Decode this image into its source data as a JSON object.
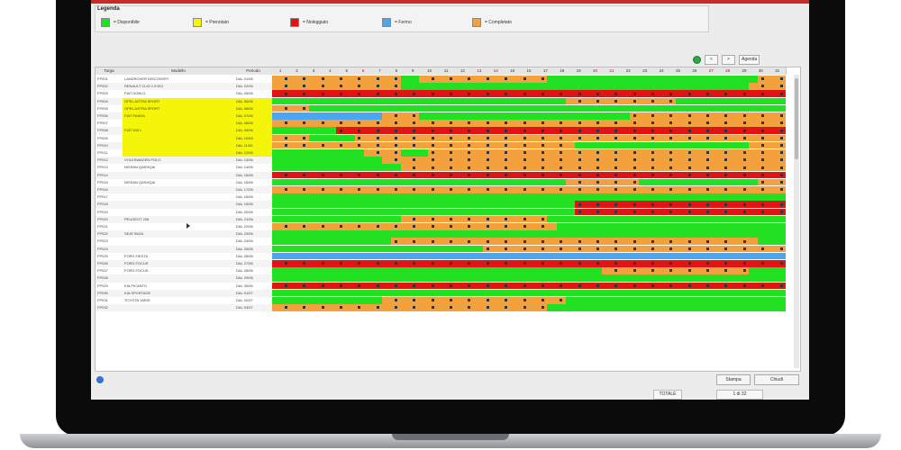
{
  "legend": {
    "title": "Legenda",
    "items": [
      {
        "key": "avail",
        "label": "= Disponibile",
        "color": "#22e122"
      },
      {
        "key": "pren",
        "label": "= Prenotato",
        "color": "#f5f50a"
      },
      {
        "key": "rent",
        "label": "= Noleggiato",
        "color": "#e01414"
      },
      {
        "key": "block",
        "label": "= Fermo",
        "color": "#4aa6f0"
      },
      {
        "key": "part",
        "label": "= Completato",
        "color": "#f2a13c"
      }
    ]
  },
  "toolbar": {
    "btn1": "<",
    "btn2": ">",
    "btn3": "Agenda"
  },
  "columns": {
    "plate": "Targa",
    "model": "Modello",
    "period": "Periodo"
  },
  "days": [
    "1",
    "2",
    "3",
    "4",
    "5",
    "6",
    "7",
    "8",
    "9",
    "10",
    "11",
    "12",
    "13",
    "14",
    "15",
    "16",
    "17",
    "18",
    "19",
    "20",
    "21",
    "22",
    "23",
    "24",
    "25",
    "26",
    "27",
    "28",
    "29",
    "30",
    "31"
  ],
  "rows": [
    {
      "plate": "FP001",
      "model": "LANDROVER DISCOVERY",
      "period": "DAL 01/06",
      "yellow": false,
      "cells": "ppppppppppppppggppppppppppppppgggggggggggggggggggggggp"
    },
    {
      "plate": "FP002",
      "model": "RENAULT CLIO 1.5 DCI",
      "period": "DAL 02/06",
      "yellow": false,
      "cells": "ppppppppppppppggggggggggggggggggggggggggggggggggggggp"
    },
    {
      "plate": "FP003",
      "model": "FIAT DOBLO",
      "period": "DAL 05/06",
      "yellow": false,
      "cells": "rrrrrrrrrrrrrrrrrrrrrrrrrrrrrrrrrrrrrrrrrrrrrrrrrrrrrr"
    },
    {
      "plate": "FP004",
      "model": "OPEL ASTRA SPORT",
      "period": "DAL 06/06",
      "yellow": true,
      "cells": "ggggggggggggggggggggggggggggggggppppppppppppggggggggggggg"
    },
    {
      "plate": "FP005",
      "model": "OPEL ASTRA SPORT",
      "period": "DAL 06/06",
      "yellow": true,
      "cells": "ppppggggggggggggggggggggggggggggggggggggggggggggggggggggg"
    },
    {
      "plate": "FP006",
      "model": "FIAT PANDA",
      "period": "DAL 07/06",
      "yellow": true,
      "cells": "bbbbbbbbbbbbppppgggggggggggggggggggggggppppppppppppppppp"
    },
    {
      "plate": "FP007",
      "model": "",
      "period": "DAL 08/06",
      "yellow": true,
      "cells": "ppppppppppppppppppppppppppppppppppppppppppppppppppppppp"
    },
    {
      "plate": "FP008",
      "model": "FIAT 500 L",
      "period": "DAL 09/06",
      "yellow": true,
      "cells": "gggggggrrrrrrrrrrrrrrrrrrrrrrrrrrrrrrrrrrrrrrrrrrrrrrrr"
    },
    {
      "plate": "FP009",
      "model": "",
      "period": "DAL 10/06",
      "yellow": true,
      "cells": "ppppgggggpppppppppppppppppppppppppppppppppppppppppppppp"
    },
    {
      "plate": "FP010",
      "model": "",
      "period": "DAL 11/06",
      "yellow": true,
      "cells": "pppppppppppppppppppppppppppppppppgggggggggggggggggggpppp"
    },
    {
      "plate": "FP011",
      "model": "",
      "period": "DAL 12/06",
      "yellow": true,
      "cells": "ggggggggggppppgggppppppppppppppppppppppppppppppppppppppp"
    },
    {
      "plate": "FP012",
      "model": "VOLKSWAGEN POLO",
      "period": "DAL 13/06",
      "yellow": false,
      "cells": "ggggggggggggppppppppppppppppppppppppppppppppppppppppppp"
    },
    {
      "plate": "FP013",
      "model": "NISSAN QASHQAI",
      "period": "DAL 14/06",
      "yellow": false,
      "cells": "ggggggggggggggppppppppppppppppppppppppppppppppppppppppp"
    },
    {
      "plate": "FP014",
      "model": "",
      "period": "DAL 15/06",
      "yellow": false,
      "cells": "rrrrrrrrrrrrrrrrrrrrrrrrrrrrrrrrrrrrrrrrrrrrrrrrrrrrrrr"
    },
    {
      "plate": "FP015",
      "model": "NISSAN QASHQAI",
      "period": "DAL 16/06",
      "yellow": false,
      "cells": "ggggggggggggggggggggggggggggggggppppppppgggggggggggggpp"
    },
    {
      "plate": "FP016",
      "model": "",
      "period": "DAL 17/06",
      "yellow": false,
      "cells": "ppppppppppppppppppppppppppppppppppppppppppppppppppppppp"
    },
    {
      "plate": "FP017",
      "model": "",
      "period": "DAL 18/06",
      "yellow": false,
      "cells": "ggggggggggggggggggggggggggggggggggggggggggggggggggggggg"
    },
    {
      "plate": "FP018",
      "model": "",
      "period": "DAL 19/06",
      "yellow": false,
      "cells": "gggggggggggggggggggggggggggggggggrrrrrrrrrrrrrrrrrrrrrr"
    },
    {
      "plate": "FP019",
      "model": "",
      "period": "DAL 20/06",
      "yellow": false,
      "cells": "gggggggggggggggggggggggggggggggggrrrrrrrrrrrrrrrrrrrrrr"
    },
    {
      "plate": "FP020",
      "model": "PEUGEOT 208",
      "period": "DAL 21/06",
      "yellow": false,
      "cells": "ggggggggggggggppppppppppppppppgggggggggggggggggggggggggg"
    },
    {
      "plate": "FP021",
      "model": "",
      "period": "DAL 22/06",
      "yellow": false,
      "cells": "pppppppppppppppppppppppppppppppgggggggggggggggggggggggg"
    },
    {
      "plate": "FP022",
      "model": "SEAT IBIZA",
      "period": "DAL 23/06",
      "yellow": false,
      "cells": "ggggggggggggggggggggggggggggggggggggggggggggggggggggggg"
    },
    {
      "plate": "FP023",
      "model": "",
      "period": "DAL 24/06",
      "yellow": false,
      "cells": "gggggggggggggppppppppppppppppppppppppppppppppppppppppgg"
    },
    {
      "plate": "FP024",
      "model": "",
      "period": "DAL 25/06",
      "yellow": false,
      "cells": "gggggggggggggggggggggggppppppppppppppppppppppppppppppp"
    },
    {
      "plate": "FP025",
      "model": "FORD FIESTA",
      "period": "DAL 26/06",
      "yellow": false,
      "cells": "bbbbbbbbbbbbbbbbbbbbbbbbbbbbbbbbbbbbbbbbbbbbbbbbbbbbbbb"
    },
    {
      "plate": "FP026",
      "model": "FORD FOCUS",
      "period": "DAL 27/06",
      "yellow": false,
      "cells": "rrrrrrrrrrrrrrrrrrrrrrrrrrrrrrrrrrrrrrrrrrrrrrrrrrrrrrr"
    },
    {
      "plate": "FP027",
      "model": "FORD FOCUS",
      "period": "DAL 28/06",
      "yellow": false,
      "cells": "ggggggggggggggggggggggggggggggggggggppppppppppppppppggg"
    },
    {
      "plate": "FP028",
      "model": "",
      "period": "DAL 29/06",
      "yellow": false,
      "cells": "ggggggggggggggggggggggggggggggggggggggggggggggggggggggg"
    },
    {
      "plate": "FP029",
      "model": "KIA PICANTO",
      "period": "DAL 30/06",
      "yellow": false,
      "cells": "rrrrrrrrrrrrrrrrrrrrrrrrrrrrrrrrrrrrrrrrrrrrrrrrrrrrrrr"
    },
    {
      "plate": "FP030",
      "model": "KIA SPORTAGE",
      "period": "DAL 01/07",
      "yellow": false,
      "cells": "ggggggggggggggggggggggggggggggggggggggggggggggggggggggg"
    },
    {
      "plate": "FP031",
      "model": "TOYOTA YARIS",
      "period": "DAL 02/07",
      "yellow": false,
      "cells": "ggggggggggggppppppppppppppppppppgggggggggggggggggggggg"
    },
    {
      "plate": "FP032",
      "model": "",
      "period": "DAL 03/07",
      "yellow": false,
      "cells": "ppppppppppppppppppppppppppppppgggggggggggggggggggggggggg"
    }
  ],
  "bottom": {
    "btn_left": "Stampa",
    "btn_right": "Chiudi",
    "status1": "TOTALE",
    "status2": "1 di 32"
  }
}
